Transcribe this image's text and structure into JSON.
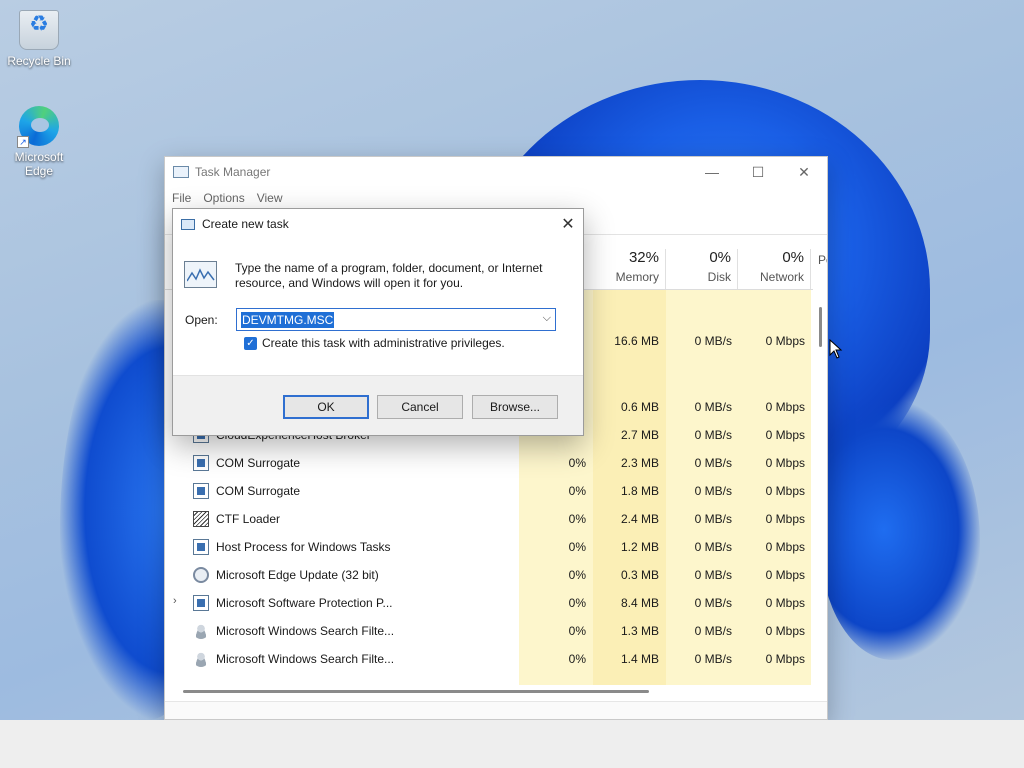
{
  "desktop": {
    "icons": [
      {
        "label": "Recycle Bin",
        "icon": "recycle-bin-icon"
      },
      {
        "label": "Microsoft Edge",
        "icon": "edge-icon"
      }
    ]
  },
  "task_manager": {
    "title": "Task Manager",
    "menu": [
      "File",
      "Options",
      "View"
    ],
    "columns": [
      {
        "pct": "32%",
        "label": "Memory"
      },
      {
        "pct": "0%",
        "label": "Disk"
      },
      {
        "pct": "0%",
        "label": "Network"
      },
      {
        "pct": "",
        "label": "Po"
      }
    ],
    "rows": [
      {
        "name": "",
        "cpu": "",
        "memory": "16.6 MB",
        "disk": "0 MB/s",
        "network": "0 Mbps"
      },
      {
        "name": "",
        "cpu": "",
        "memory": "0.6 MB",
        "disk": "0 MB/s",
        "network": "0 Mbps"
      },
      {
        "name": "CloudExperienceHost Broker",
        "cpu": "",
        "memory": "2.7 MB",
        "disk": "0 MB/s",
        "network": "0 Mbps"
      },
      {
        "name": "COM Surrogate",
        "cpu": "0%",
        "memory": "2.3 MB",
        "disk": "0 MB/s",
        "network": "0 Mbps"
      },
      {
        "name": "COM Surrogate",
        "cpu": "0%",
        "memory": "1.8 MB",
        "disk": "0 MB/s",
        "network": "0 Mbps"
      },
      {
        "name": "CTF Loader",
        "cpu": "0%",
        "memory": "2.4 MB",
        "disk": "0 MB/s",
        "network": "0 Mbps"
      },
      {
        "name": "Host Process for Windows Tasks",
        "cpu": "0%",
        "memory": "1.2 MB",
        "disk": "0 MB/s",
        "network": "0 Mbps"
      },
      {
        "name": "Microsoft Edge Update (32 bit)",
        "cpu": "0%",
        "memory": "0.3 MB",
        "disk": "0 MB/s",
        "network": "0 Mbps"
      },
      {
        "name": "Microsoft Software Protection P...",
        "cpu": "0%",
        "memory": "8.4 MB",
        "disk": "0 MB/s",
        "network": "0 Mbps"
      },
      {
        "name": "Microsoft Windows Search Filte...",
        "cpu": "0%",
        "memory": "1.3 MB",
        "disk": "0 MB/s",
        "network": "0 Mbps"
      },
      {
        "name": "Microsoft Windows Search Filte...",
        "cpu": "0%",
        "memory": "1.4 MB",
        "disk": "0 MB/s",
        "network": "0 Mbps"
      }
    ]
  },
  "dialog": {
    "title": "Create new task",
    "message": "Type the name of a program, folder, document, or Internet resource, and Windows will open it for you.",
    "open_label": "Open:",
    "open_value": "DEVMTMG.MSC",
    "admin_checkbox_label": "Create this task with administrative privileges.",
    "admin_checked": true,
    "ok_label": "OK",
    "cancel_label": "Cancel",
    "browse_label": "Browse..."
  }
}
